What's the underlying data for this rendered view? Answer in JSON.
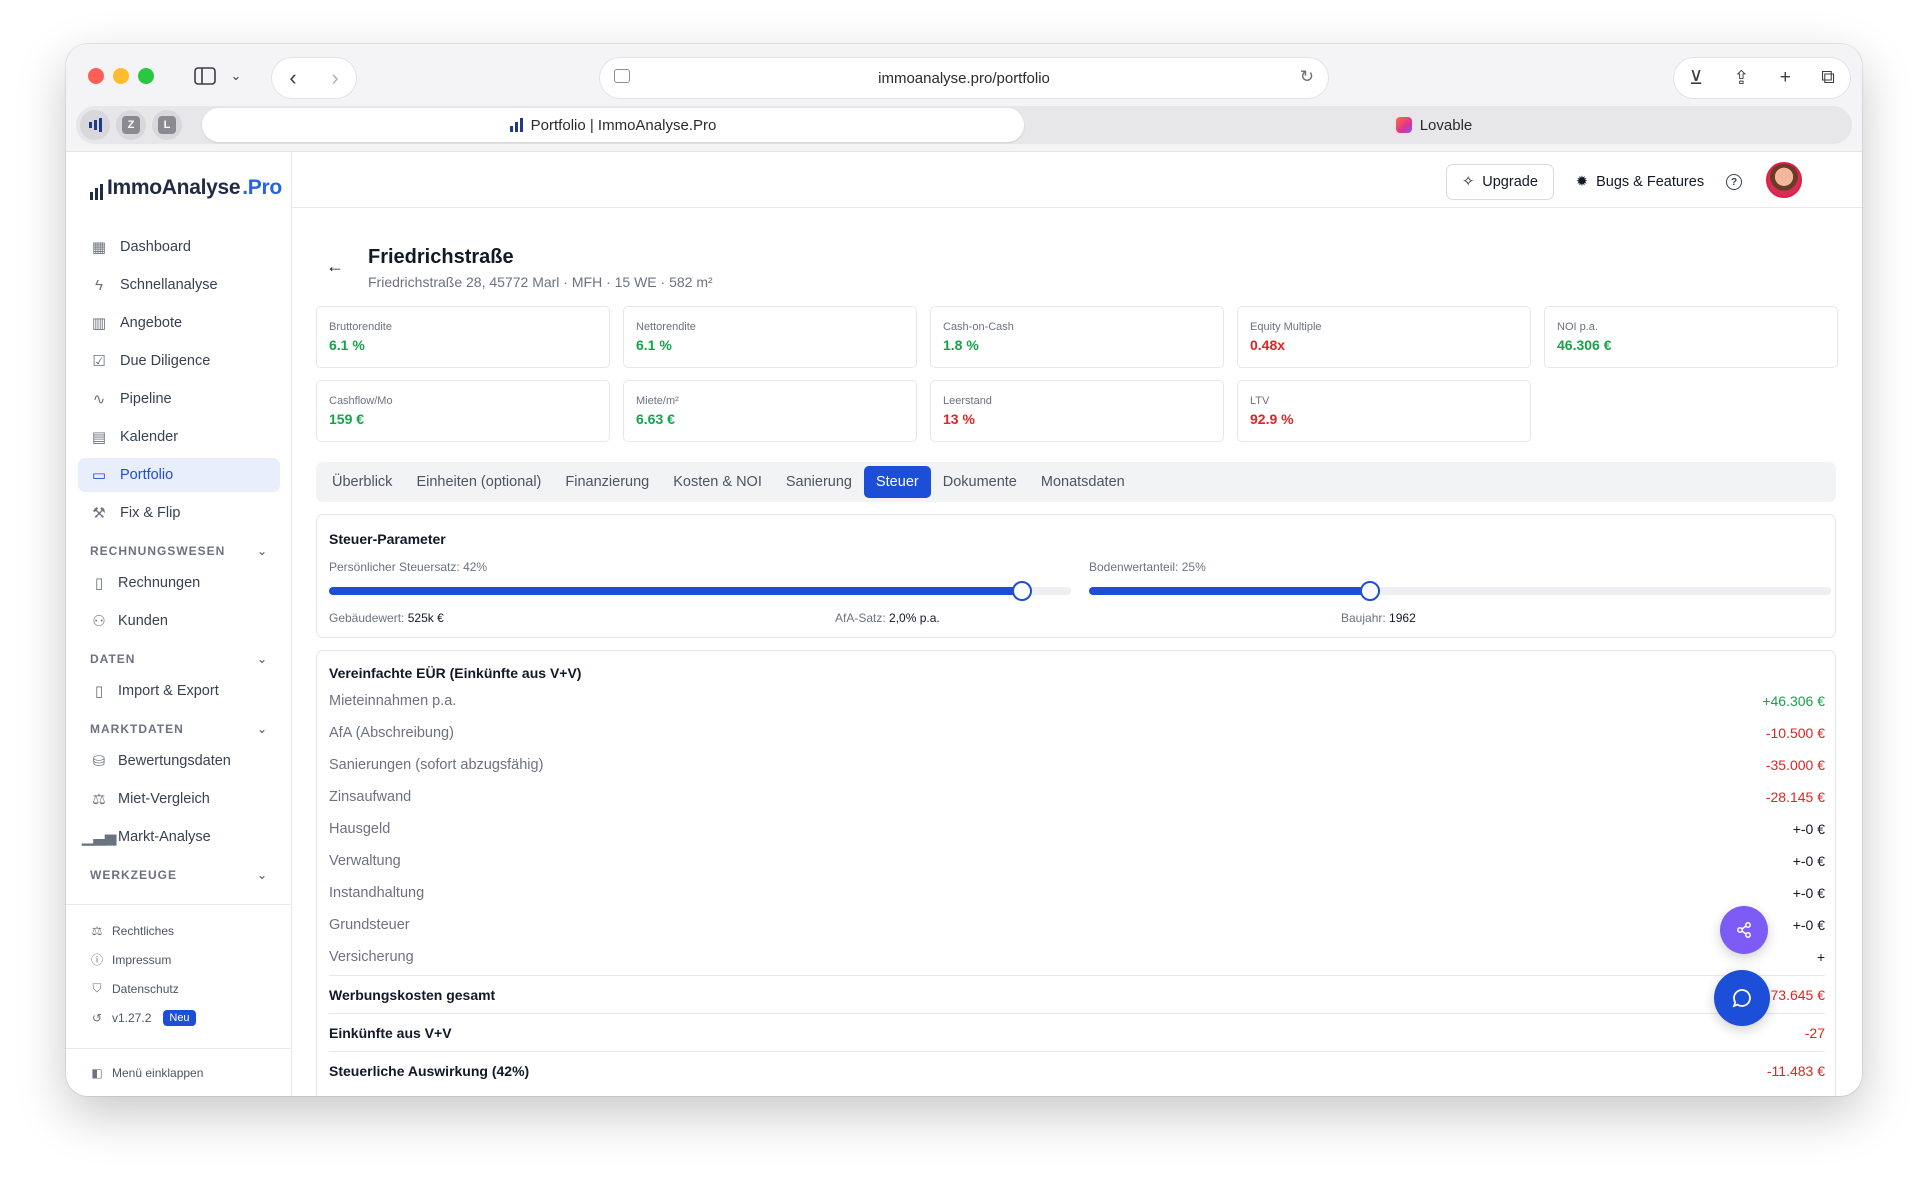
{
  "browser": {
    "url": "immoanalyse.pro/portfolio",
    "tabs": [
      {
        "label": "Portfolio | ImmoAnalyse.Pro",
        "active": true
      },
      {
        "label": "Lovable",
        "active": false
      }
    ],
    "pinned": [
      "Z",
      "L"
    ]
  },
  "sidebar": {
    "logo_main": "ImmoAnalyse",
    "logo_pro": ".Pro",
    "nav": [
      {
        "label": "Dashboard",
        "icon": "grid-icon"
      },
      {
        "label": "Schnellanalyse",
        "icon": "bolt-icon"
      },
      {
        "label": "Angebote",
        "icon": "building-icon"
      },
      {
        "label": "Due Diligence",
        "icon": "clipboard-icon"
      },
      {
        "label": "Pipeline",
        "icon": "activity-icon"
      },
      {
        "label": "Kalender",
        "icon": "calendar-icon"
      },
      {
        "label": "Portfolio",
        "icon": "briefcase-icon",
        "active": true
      },
      {
        "label": "Fix & Flip",
        "icon": "hammer-icon"
      }
    ],
    "sections": {
      "rechnungswesen": {
        "title": "RECHNUNGSWESEN",
        "items": [
          "Rechnungen",
          "Kunden"
        ]
      },
      "daten": {
        "title": "DATEN",
        "items": [
          "Import & Export"
        ]
      },
      "marktdaten": {
        "title": "MARKTDATEN",
        "items": [
          "Bewertungsdaten",
          "Miet-Vergleich",
          "Markt-Analyse"
        ]
      },
      "werkzeuge": {
        "title": "WERKZEUGE"
      }
    },
    "footer": {
      "rechtliches": "Rechtliches",
      "impressum": "Impressum",
      "datenschutz": "Datenschutz",
      "version": "v1.27.2",
      "badge": "Neu",
      "collapse": "Menü einklappen"
    }
  },
  "topbar": {
    "upgrade": "Upgrade",
    "bugs": "Bugs & Features"
  },
  "property": {
    "title": "Friedrichstraße",
    "subtitle": "Friedrichstraße 28, 45772 Marl · MFH · 15 WE · 582 m²"
  },
  "kpis": [
    {
      "label": "Bruttorendite",
      "value": "6.1 %",
      "tone": "green"
    },
    {
      "label": "Nettorendite",
      "value": "6.1 %",
      "tone": "green"
    },
    {
      "label": "Cash-on-Cash",
      "value": "1.8 %",
      "tone": "green"
    },
    {
      "label": "Equity Multiple",
      "value": "0.48x",
      "tone": "red"
    },
    {
      "label": "NOI p.a.",
      "value": "46.306 €",
      "tone": "green"
    },
    {
      "label": "Cashflow/Mo",
      "value": "159 €",
      "tone": "green"
    },
    {
      "label": "Miete/m²",
      "value": "6.63 €",
      "tone": "green"
    },
    {
      "label": "Leerstand",
      "value": "13 %",
      "tone": "red"
    },
    {
      "label": "LTV",
      "value": "92.9 %",
      "tone": "red"
    }
  ],
  "tabs": [
    "Überblick",
    "Einheiten (optional)",
    "Finanzierung",
    "Kosten & NOI",
    "Sanierung",
    "Steuer",
    "Dokumente",
    "Monatsdaten"
  ],
  "active_tab": "Steuer",
  "steuer": {
    "title": "Steuer-Parameter",
    "steuersatz_label": "Persönlicher Steuersatz: 42%",
    "steuersatz_value": 42,
    "bodenwert_label": "Bodenwertanteil: 25%",
    "bodenwert_value": 25,
    "gebaeudewert_label": "Gebäudewert:",
    "gebaeudewert_value": "525k €",
    "afa_label": "AfA-Satz:",
    "afa_value": "2,0% p.a.",
    "baujahr_label": "Baujahr:",
    "baujahr_value": "1962"
  },
  "eur": {
    "title": "Vereinfachte EÜR (Einkünfte aus V+V)",
    "rows": [
      {
        "label": "Mieteinnahmen p.a.",
        "value": "+46.306 €",
        "tone": "green"
      },
      {
        "label": "AfA (Abschreibung)",
        "value": "-10.500 €",
        "tone": "red"
      },
      {
        "label": "Sanierungen (sofort abzugsfähig)",
        "value": "-35.000 €",
        "tone": "red"
      },
      {
        "label": "Zinsaufwand",
        "value": "-28.145 €",
        "tone": "red"
      },
      {
        "label": "Hausgeld",
        "value": "+-0 €",
        "tone": "neutral"
      },
      {
        "label": "Verwaltung",
        "value": "+-0 €",
        "tone": "neutral"
      },
      {
        "label": "Instandhaltung",
        "value": "+-0 €",
        "tone": "neutral"
      },
      {
        "label": "Grundsteuer",
        "value": "+-0 €",
        "tone": "neutral"
      },
      {
        "label": "Versicherung",
        "value": "+",
        "tone": "neutral"
      }
    ],
    "totals": [
      {
        "label": "Werbungskosten gesamt",
        "value": "-73.645 €",
        "tone": "red"
      },
      {
        "label": "Einkünfte aus V+V",
        "value": "-27",
        "tone": "red"
      },
      {
        "label": "Steuerliche Auswirkung (42%)",
        "value": "-11.483 €",
        "tone": "red"
      }
    ]
  },
  "colors": {
    "accent": "#1d4ed8",
    "positive": "#16a34a",
    "negative": "#dc2626",
    "share_fab": "#7c5cf5"
  }
}
